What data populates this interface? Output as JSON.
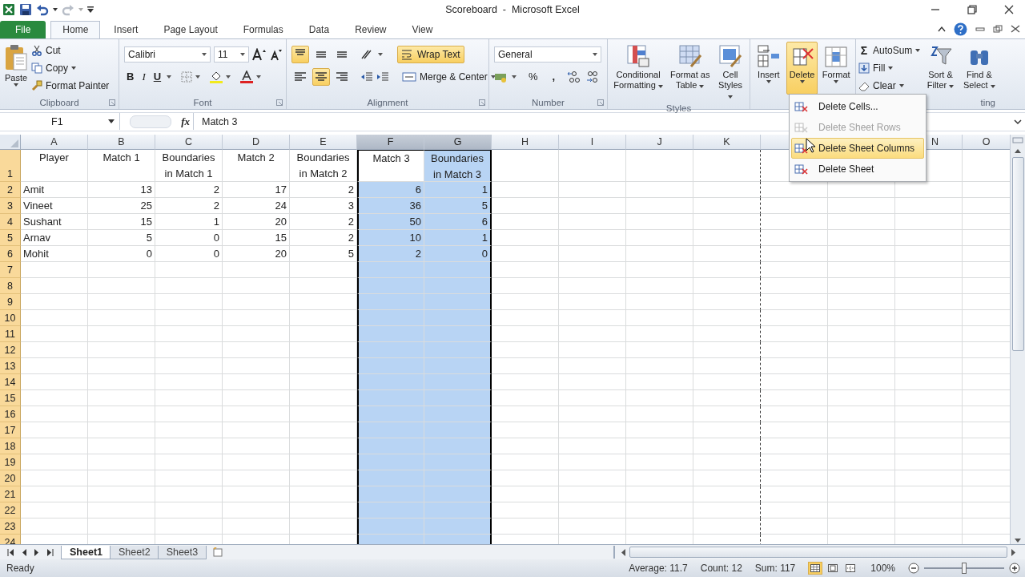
{
  "window": {
    "title": "Scoreboard  -  Microsoft Excel"
  },
  "menu_tabs": [
    {
      "label": "File",
      "kind": "file",
      "selected": false
    },
    {
      "label": "Home",
      "kind": "tab",
      "selected": true
    },
    {
      "label": "Insert",
      "kind": "tab",
      "selected": false
    },
    {
      "label": "Page Layout",
      "kind": "tab",
      "selected": false
    },
    {
      "label": "Formulas",
      "kind": "tab",
      "selected": false
    },
    {
      "label": "Data",
      "kind": "tab",
      "selected": false
    },
    {
      "label": "Review",
      "kind": "tab",
      "selected": false
    },
    {
      "label": "View",
      "kind": "tab",
      "selected": false
    }
  ],
  "ribbon": {
    "clipboard": {
      "label": "Clipboard",
      "paste": "Paste",
      "cut": "Cut",
      "copy": "Copy",
      "format_painter": "Format Painter"
    },
    "font": {
      "label": "Font",
      "name": "Calibri",
      "size": "11",
      "bold": "B",
      "italic": "I",
      "underline": "U"
    },
    "alignment": {
      "label": "Alignment",
      "top_align": {
        "selected": true
      },
      "middle_align": {
        "selected": false
      },
      "bottom_align": {
        "selected": false
      },
      "wrap_text": {
        "label": "Wrap Text",
        "selected": true
      },
      "align_left": {
        "selected": false
      },
      "center": {
        "selected": true
      },
      "align_right": {
        "selected": false
      },
      "merge_center": {
        "label": "Merge & Center"
      }
    },
    "number": {
      "label": "Number",
      "format": "General",
      "percent": "%",
      "comma": ","
    },
    "styles": {
      "label": "Styles",
      "conditional_formatting": "Conditional Formatting",
      "format_as_table": "Format as Table",
      "cell_styles": "Cell Styles"
    },
    "cells": {
      "insert": {
        "label": "Insert",
        "selected": false
      },
      "delete": {
        "label": "Delete",
        "selected": true
      },
      "format": {
        "label": "Format",
        "selected": false
      }
    },
    "editing": {
      "label": "ting",
      "sigma": "Σ",
      "autosum": "AutoSum",
      "fill": "Fill",
      "clear": "Clear",
      "sort_filter": "Sort & Filter",
      "find_select": "Find & Select"
    }
  },
  "formula_bar": {
    "name_box": "F1",
    "fx": "fx",
    "value": "Match 3"
  },
  "sheet": {
    "columns": [
      {
        "letter": "A",
        "selected": false
      },
      {
        "letter": "B",
        "selected": false
      },
      {
        "letter": "C",
        "selected": false
      },
      {
        "letter": "D",
        "selected": false
      },
      {
        "letter": "E",
        "selected": false
      },
      {
        "letter": "F",
        "selected": true
      },
      {
        "letter": "G",
        "selected": true
      },
      {
        "letter": "H",
        "selected": false
      },
      {
        "letter": "I",
        "selected": false
      },
      {
        "letter": "J",
        "selected": false
      },
      {
        "letter": "K",
        "selected": false
      },
      {
        "selected": false
      },
      {
        "selected": false
      },
      {
        "letter": "N",
        "selected": false
      },
      {
        "letter": "O",
        "selected": false
      }
    ],
    "rows": [
      {
        "number": "1",
        "cells": [
          "Player",
          "Match 1",
          "Boundaries in Match 1",
          "Match 2",
          "Boundaries in Match 2",
          "Match 3",
          "Boundaries in Match 3"
        ]
      },
      {
        "number": "2",
        "cells": [
          "Amit",
          "13",
          "2",
          "17",
          "2",
          "6",
          "1"
        ]
      },
      {
        "number": "3",
        "cells": [
          "Vineet",
          "25",
          "2",
          "24",
          "3",
          "36",
          "5"
        ]
      },
      {
        "number": "4",
        "cells": [
          "Sushant",
          "15",
          "1",
          "20",
          "2",
          "50",
          "6"
        ]
      },
      {
        "number": "5",
        "cells": [
          "Arnav",
          "5",
          "0",
          "15",
          "2",
          "10",
          "1"
        ]
      },
      {
        "number": "6",
        "cells": [
          "Mohit",
          "0",
          "0",
          "20",
          "5",
          "2",
          "0"
        ]
      },
      {
        "number": "7"
      },
      {
        "number": "8"
      },
      {
        "number": "9"
      },
      {
        "number": "10"
      },
      {
        "number": "11"
      },
      {
        "number": "12"
      },
      {
        "number": "13"
      },
      {
        "number": "14"
      },
      {
        "number": "15"
      },
      {
        "number": "16"
      },
      {
        "number": "17"
      },
      {
        "number": "18"
      },
      {
        "number": "19"
      },
      {
        "number": "20"
      },
      {
        "number": "21"
      },
      {
        "number": "22"
      },
      {
        "number": "23"
      },
      {
        "number": "24"
      }
    ]
  },
  "delete_menu": {
    "items": [
      {
        "label": "Delete Cells...",
        "disabled": false,
        "selected": false
      },
      {
        "label": "Delete Sheet Rows",
        "disabled": true,
        "selected": false
      },
      {
        "label": "Delete Sheet Columns",
        "disabled": false,
        "selected": true
      },
      {
        "label": "Delete Sheet",
        "disabled": false,
        "selected": false
      }
    ]
  },
  "sheet_tabs": [
    {
      "label": "Sheet1",
      "selected": true
    },
    {
      "label": "Sheet2",
      "selected": false
    },
    {
      "label": "Sheet3",
      "selected": false
    }
  ],
  "status_bar": {
    "status": "Ready",
    "average": "Average: 11.7",
    "count": "Count: 12",
    "sum": "Sum: 117",
    "views": [
      {
        "selected": true
      },
      {
        "selected": false
      },
      {
        "selected": false
      }
    ],
    "zoom": "100%",
    "zoom_slider": {
      "level": 0.5
    }
  }
}
